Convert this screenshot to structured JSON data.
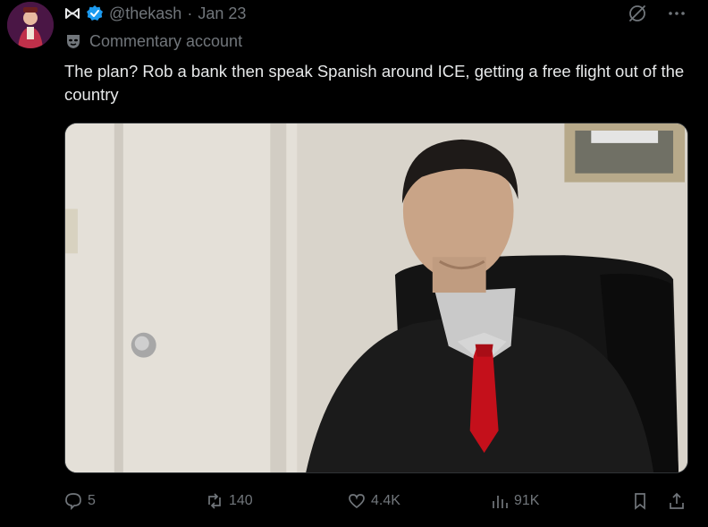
{
  "post": {
    "handle": "@thekash",
    "separator": "·",
    "date": "Jan 23",
    "account_label": "Commentary account",
    "text": "The plan? Rob a bank then speak Spanish around ICE, getting a free flight out of the country"
  },
  "icons": {
    "brand": "bowtie-icon",
    "verified": "verified-badge-icon",
    "label": "mask-icon",
    "grok": "grok-icon",
    "more": "more-icon"
  },
  "actions": {
    "replies": "5",
    "reposts": "140",
    "likes": "4.4K",
    "views": "91K"
  },
  "colors": {
    "background": "#000000",
    "text": "#e7e9ea",
    "muted": "#71767b",
    "verified": "#1d9bf0"
  }
}
